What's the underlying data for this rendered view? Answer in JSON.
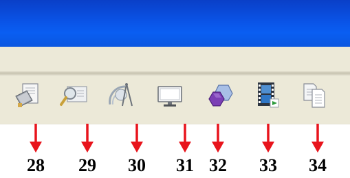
{
  "toolbar": {
    "buttons": [
      {
        "icon": "book-document-icon",
        "callout": "28"
      },
      {
        "icon": "search-document-icon",
        "callout": "29"
      },
      {
        "icon": "drafting-compass-icon",
        "callout": "30"
      },
      {
        "icon": "monitor-icon",
        "callout": "31"
      },
      {
        "icon": "shapes-icon",
        "callout": "32"
      },
      {
        "icon": "film-strip-icon",
        "callout": "33"
      },
      {
        "icon": "copy-documents-icon",
        "callout": "34"
      }
    ]
  },
  "colors": {
    "titlebar": "#0a53e6",
    "toolbar_bg": "#ece9d8",
    "arrow": "#e8141c",
    "callout_text": "#000000"
  }
}
